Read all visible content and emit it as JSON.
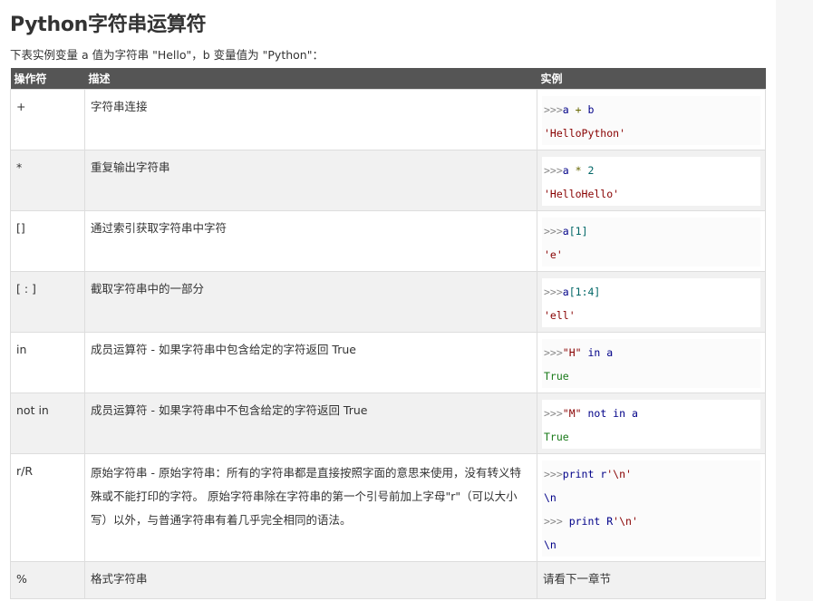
{
  "page": {
    "title": "Python字符串运算符",
    "intro": "下表实例变量 a 值为字符串 \"Hello\"，b 变量值为 \"Python\"："
  },
  "table": {
    "headers": [
      "操作符",
      "描述",
      "实例"
    ],
    "rows": [
      {
        "op": "+",
        "desc": "字符串连接",
        "lines": [
          [
            {
              "t": ">>>",
              "c": "prompt"
            },
            {
              "t": "a",
              "c": "kw"
            },
            {
              "t": " + ",
              "c": "op"
            },
            {
              "t": "b",
              "c": "kw"
            }
          ],
          [
            {
              "t": "'HelloPython'",
              "c": "str"
            }
          ]
        ]
      },
      {
        "op": "*",
        "desc": "重复输出字符串",
        "lines": [
          [
            {
              "t": ">>>",
              "c": "prompt"
            },
            {
              "t": "a",
              "c": "kw"
            },
            {
              "t": " * ",
              "c": "op"
            },
            {
              "t": "2",
              "c": "num"
            }
          ],
          [
            {
              "t": "'HelloHello'",
              "c": "str"
            }
          ]
        ]
      },
      {
        "op": "[]",
        "desc": "通过索引获取字符串中字符",
        "lines": [
          [
            {
              "t": ">>>",
              "c": "prompt"
            },
            {
              "t": "a",
              "c": "kw"
            },
            {
              "t": "[1]",
              "c": "num"
            }
          ],
          [
            {
              "t": "'e'",
              "c": "str"
            }
          ]
        ]
      },
      {
        "op": "[ : ]",
        "desc": "截取字符串中的一部分",
        "lines": [
          [
            {
              "t": ">>>",
              "c": "prompt"
            },
            {
              "t": "a",
              "c": "kw"
            },
            {
              "t": "[1:4]",
              "c": "num"
            }
          ],
          [
            {
              "t": "'ell'",
              "c": "str"
            }
          ]
        ]
      },
      {
        "op": "in",
        "desc": "成员运算符 - 如果字符串中包含给定的字符返回 True",
        "lines": [
          [
            {
              "t": ">>>",
              "c": "prompt"
            },
            {
              "t": "\"H\"",
              "c": "str"
            },
            {
              "t": " in a",
              "c": "kw"
            }
          ],
          [
            {
              "t": "True",
              "c": "true"
            }
          ]
        ]
      },
      {
        "op": "not in",
        "desc": "成员运算符 - 如果字符串中不包含给定的字符返回 True",
        "lines": [
          [
            {
              "t": ">>>",
              "c": "prompt"
            },
            {
              "t": "\"M\"",
              "c": "str"
            },
            {
              "t": " not in a",
              "c": "kw"
            }
          ],
          [
            {
              "t": "True",
              "c": "true"
            }
          ]
        ]
      },
      {
        "op": "r/R",
        "desc": "原始字符串 - 原始字符串：所有的字符串都是直接按照字面的意思来使用，没有转义特殊或不能打印的字符。 原始字符串除在字符串的第一个引号前加上字母\"r\"（可以大小写）以外，与普通字符串有着几乎完全相同的语法。",
        "lines": [
          [
            {
              "t": ">>>",
              "c": "prompt"
            },
            {
              "t": "print r",
              "c": "kw"
            },
            {
              "t": "'\\n'",
              "c": "str"
            }
          ],
          [
            {
              "t": "\\n",
              "c": "esc"
            }
          ],
          [
            {
              "t": ">>> ",
              "c": "prompt"
            },
            {
              "t": "print R",
              "c": "kw"
            },
            {
              "t": "'\\n'",
              "c": "str"
            }
          ],
          [
            {
              "t": "\\n",
              "c": "esc"
            }
          ]
        ]
      },
      {
        "op": "%",
        "desc": "格式字符串",
        "plain": "请看下一章节"
      }
    ]
  }
}
